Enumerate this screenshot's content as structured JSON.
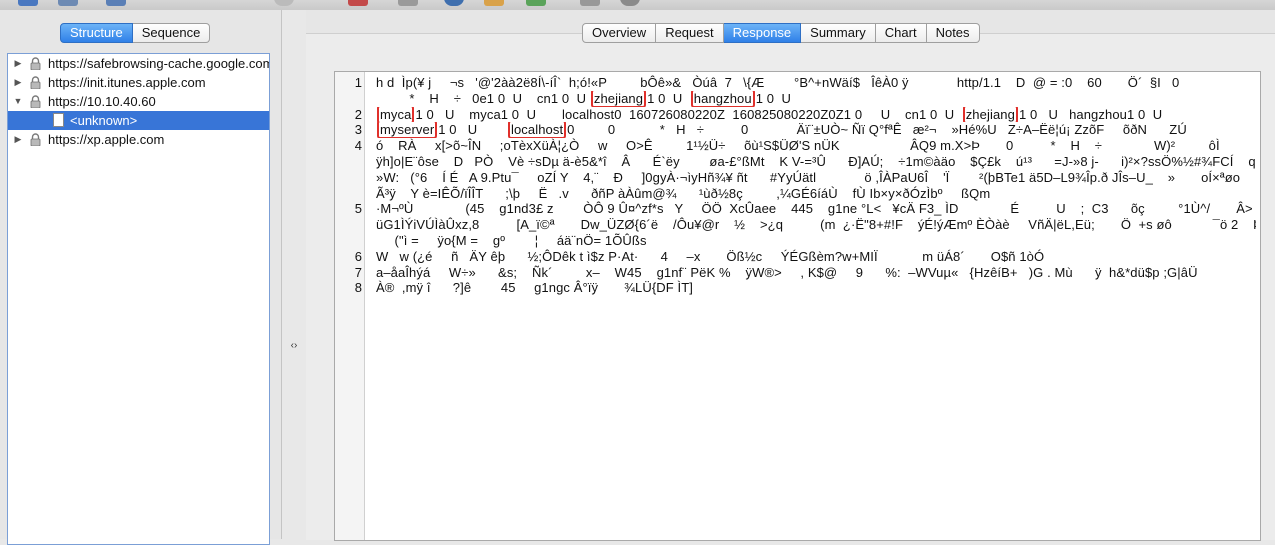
{
  "left_panel": {
    "view_tabs": [
      "Structure",
      "Sequence"
    ],
    "active_view_tab": "Structure",
    "hosts": [
      {
        "label": "https://safebrowsing-cache.google.com",
        "expanded": false,
        "lock": true
      },
      {
        "label": "https://init.itunes.apple.com",
        "expanded": false,
        "lock": true
      },
      {
        "label": "https://10.10.40.60",
        "expanded": true,
        "lock": true
      },
      {
        "label": "<unknown>",
        "child": true,
        "selected": true
      },
      {
        "label": "https://xp.apple.com",
        "expanded": false,
        "lock": true
      }
    ]
  },
  "right_panel": {
    "tabs": [
      "Overview",
      "Request",
      "Response",
      "Summary",
      "Chart",
      "Notes"
    ],
    "active_tab": "Response",
    "line_numbers": [
      "1",
      "2",
      "3",
      "4",
      "5",
      "6",
      "7",
      "8"
    ],
    "lines": [
      [
        "h d  Ìp(¥ j     ¬s   '@'2àà2ë8Í\\-íÎ`  h;ó!«P         bÔê»&   Òúâ  7   \\{Æ        °B^+nWäí$   ÎêÀ0 ÿ             http/1.1    D  @ = :0    60       Ö´  §I   0"
      ],
      [
        "         *    H    ÷   0e1 0  U    cn1 0  U ",
        {
          "hl": "zhejiang"
        },
        "1 0  U  ",
        {
          "hl": "hangzhou"
        },
        "1 0  U"
      ],
      [
        {
          "hl": "myca"
        },
        "1 0   U    myca1 0  U       localhost0  160726080220Z  160825080220Z0Z1 0     U    cn1 0  U  ",
        {
          "hl": "zhejiang"
        },
        "1 0   U   hangzhou1 0  U"
      ],
      [
        {
          "hl": "myserver"
        },
        "1 0   U        ",
        {
          "hl": "localhost"
        },
        "0         0            *   H   ÷          0             Äï¨±UÒ~ Ñï Q°fªÊ   æ²¬    »Hé%U   Z÷A–Ëë¦ú¡ ZzõF     õðN      ZÚ"
      ],
      [
        "ó    RÀ     x[>õ~ÎN     ;oTèxXüÀ¦¿Ò     w     O>Ê         1¹½Ü÷     õù¹S$ÜØ'S nÜK                   ÂQ9 m.X>Þ       0          *    H    ÷              W)²         ôÌ"
      ],
      [
        "ÿh]o|E¨ôse    D   PÒ    Vè ÷sDµ ä-è5&*î    Â      É`ëy        øa-£°ßMt    K V-=³Û      Ð]AÚ;    ÷1m©àäo    $Ç£k    ú¹³      =J-»8 j-      i)²×?ssÖ%½#¾FCÍ    q"
      ],
      [
        "»W:   (°6    Í É   A 9.Ptu¯     oZÍ Y    4,¨    Ð     ]0gyÀ·¬ìyHñ¾¥ ñt      #YyÚätl             ö ,ÎÀPaU6Î    'Ï        ²(þBTe1 ä5D–L9¾Îp.ð JÎs–U_    »       oÍ×ªøo          çY)"
      ],
      [
        "Ã³ÿ    Y è=IÊÕ/ïÎÎT      ;\\þ     Ë   .v      ðñP àÀûm@¾      ¹ùð½8ç         ,¼GÉ6íáÙ    fÙ Ib×y×ðÓzÌbº     ßQm"
      ],
      [
        "·M¬ºÙ              (45    g1nd3£ z        ÒÔ 9 Û¤^zf*s   Y     ÖÖ  XcÛaee    445    g1ne °L<   ¥cÄ F3_ ÌD              É          U    ;  C3      õç         °1Ù^/       Â> çÞo"
      ],
      [
        "üG1ÌÝiVÚÌàÛxz,8          [A_ï©ª       Dw_ÜZØ{6´ë    /Ôu¥@r    ½    >¿q          (m  ¿·Ë\"8+#!F    ýÉ!ýÆmº ÈÒàè     VñÄ|ëL,Eü;       Ö  +s øô           ¯ö 2    Þüu&ñ aÉ"
      ],
      [
        "     (\"ì =     ÿo{M =    gº        ¦     áä¨nÖ= 1ÕÛßs"
      ],
      [
        "W   w (¿é     ñ   ÄY êþ      ½;ÔDêk t ì$z P·At·      4     –x       Öß½c     ÝÉGßèm?w+MIÏ            m üÁ8´       O$ñ 1òÓ"
      ],
      [
        "a–åaÎhýá     W÷»      &s;    Ñk´         x–    W45    g1nf¨ PëK %    ÿW®>     , K$@     9      %:  –WVuµ«   {HzêíB+   )G . Mù      ÿ  h&*dü$p ;G|âÜ"
      ],
      [
        "À®  ,mÿ î      ?]ê        45     g1ngc Â°ïÿ       ¾LÜ{DF ÌT]"
      ]
    ],
    "line_number_rows": [
      0,
      2,
      3,
      4,
      8,
      11,
      12,
      13
    ],
    "highlight_color": "#e0302b"
  },
  "colors": {
    "accent": "#3875d7",
    "tab_active": "#2f80e8"
  }
}
